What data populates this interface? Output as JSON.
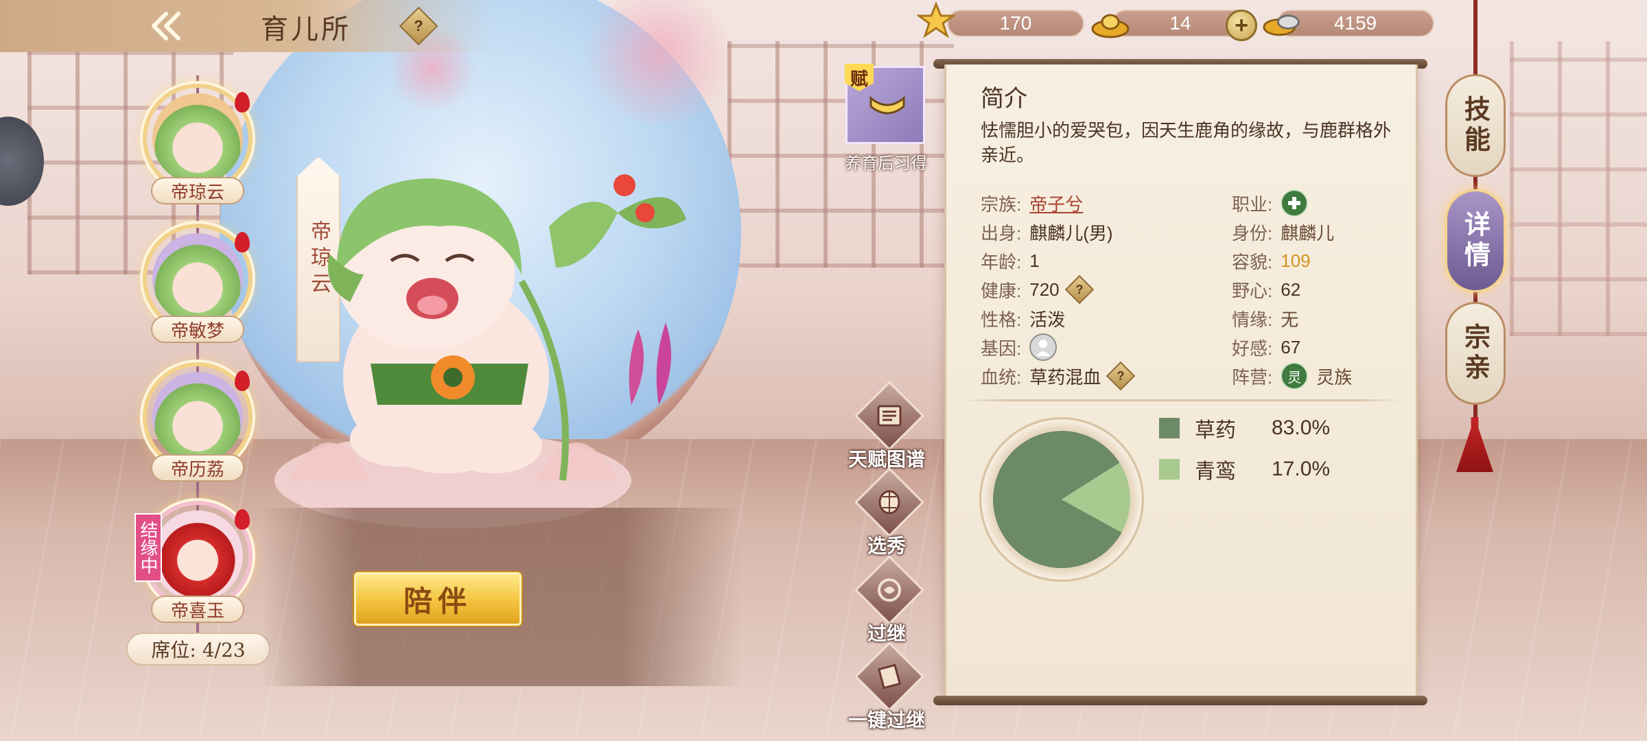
{
  "header": {
    "title": "育儿所",
    "help_label": "?",
    "currencies": [
      {
        "name": "star-currency",
        "value": "170",
        "icon": "star-icon"
      },
      {
        "name": "gold-ingot",
        "value": "14",
        "icon": "gold-ingot-icon"
      },
      {
        "name": "silver-ingot",
        "value": "4159",
        "icon": "silver-ingot-icon"
      }
    ],
    "plus_label": "+"
  },
  "children": [
    {
      "name": "帝琼云",
      "status": "selected"
    },
    {
      "name": "帝敏梦"
    },
    {
      "name": "帝历荔"
    },
    {
      "name": "帝喜玉",
      "badge": "结缘中"
    }
  ],
  "seat_label": "席位: 4/23",
  "character": {
    "banner_name": "帝琼云",
    "accompany_label": "陪伴"
  },
  "talent": {
    "tag": "赋",
    "label": "养育后习得"
  },
  "functions": [
    {
      "label": "天赋图谱",
      "icon": "talent-map-icon"
    },
    {
      "label": "选秀",
      "icon": "lantern-icon"
    },
    {
      "label": "过继",
      "icon": "transfer-icon"
    },
    {
      "label": "一键过继",
      "icon": "scroll-icon"
    }
  ],
  "panel": {
    "title": "简介",
    "intro": "怯懦胆小的爱哭包，因天生鹿角的缘故，与鹿群格外亲近。",
    "fields": {
      "clan": {
        "label": "宗族:",
        "value": "帝子兮"
      },
      "birth": {
        "label": "出身:",
        "value": "麒麟儿(男)"
      },
      "age": {
        "label": "年龄:",
        "value": "1"
      },
      "health": {
        "label": "健康:",
        "value": "720"
      },
      "personality": {
        "label": "性格:",
        "value": "活泼"
      },
      "gene": {
        "label": "基因:"
      },
      "bloodline": {
        "label": "血统:",
        "value": "草药混血"
      },
      "job": {
        "label": "职业:"
      },
      "identity": {
        "label": "身份:",
        "value": "麒麟儿"
      },
      "looks": {
        "label": "容貌:",
        "value": "109"
      },
      "ambition": {
        "label": "野心:",
        "value": "62"
      },
      "emotion": {
        "label": "情缘:",
        "value": "无"
      },
      "affection": {
        "label": "好感:",
        "value": "67"
      },
      "camp": {
        "label": "阵营:",
        "icon_text": "灵",
        "value": "灵族"
      }
    }
  },
  "chart_data": {
    "type": "pie",
    "slices": [
      {
        "label": "草药",
        "value": 83.0,
        "display": "83.0%",
        "color": "#6b8a65"
      },
      {
        "label": "青鸾",
        "value": 17.0,
        "display": "17.0%",
        "color": "#a8c98f"
      }
    ]
  },
  "tabs": [
    {
      "label": "技能",
      "active": false
    },
    {
      "label": "详情",
      "active": true
    },
    {
      "label": "宗亲",
      "active": false
    }
  ]
}
